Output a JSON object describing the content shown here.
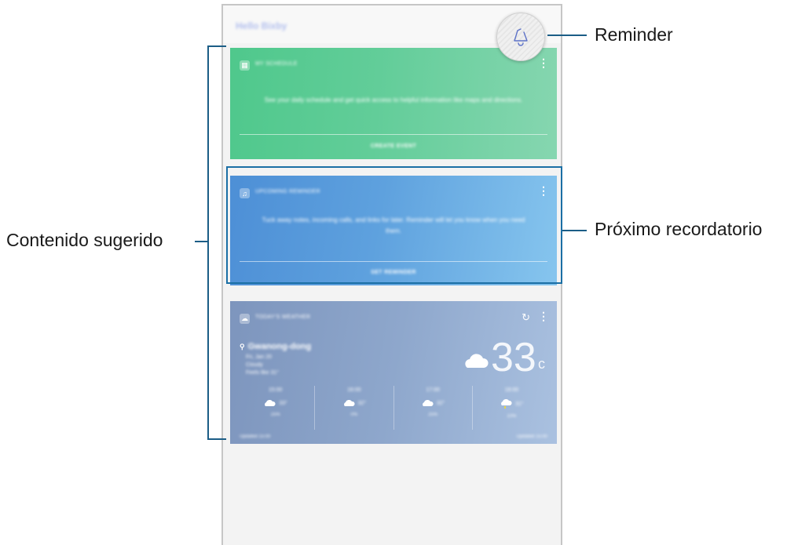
{
  "phone": {
    "greeting": "Hello Bixby"
  },
  "cards": {
    "schedule": {
      "title": "MY SCHEDULE",
      "body": "See your daily schedule and get quick access to helpful information like maps and directions.",
      "action": "CREATE EVENT"
    },
    "reminder": {
      "title": "UPCOMING REMINDER",
      "body": "Tuck away notes, incoming calls, and links for later. Reminder will let you know when you need them.",
      "action": "SET REMINDER"
    },
    "weather": {
      "title": "TODAY'S WEATHER",
      "location": "Gwanong-dong",
      "date_line": "Fri, Jan 20",
      "condition": "Cloudy",
      "feels_like": "Feels like 31°",
      "temperature": "33",
      "unit": "c",
      "hourly": [
        {
          "time": "15:00",
          "temp": "33°",
          "precip": "25%"
        },
        {
          "time": "16:00",
          "temp": "32°",
          "precip": "0%"
        },
        {
          "time": "17:00",
          "temp": "32°",
          "precip": "25%"
        },
        {
          "time": "18:00",
          "temp": "31°",
          "precip": "10%"
        }
      ],
      "footer_left": "Updated 15:00",
      "footer_right": "Updated 15:00"
    }
  },
  "callouts": {
    "reminder": "Reminder",
    "upcoming_reminder": "Próximo recordatorio",
    "suggested_content": "Contenido sugerido"
  },
  "icons": {
    "reminder_fab": "bell-reminder-icon",
    "more": "more-vert-icon",
    "refresh": "refresh-icon",
    "location": "location-pin-icon"
  },
  "colors": {
    "callout_line": "#1b5d86",
    "schedule_card": "#5ccb95",
    "reminder_card": "#5ea1de",
    "weather_card": "#8ea7cc"
  }
}
